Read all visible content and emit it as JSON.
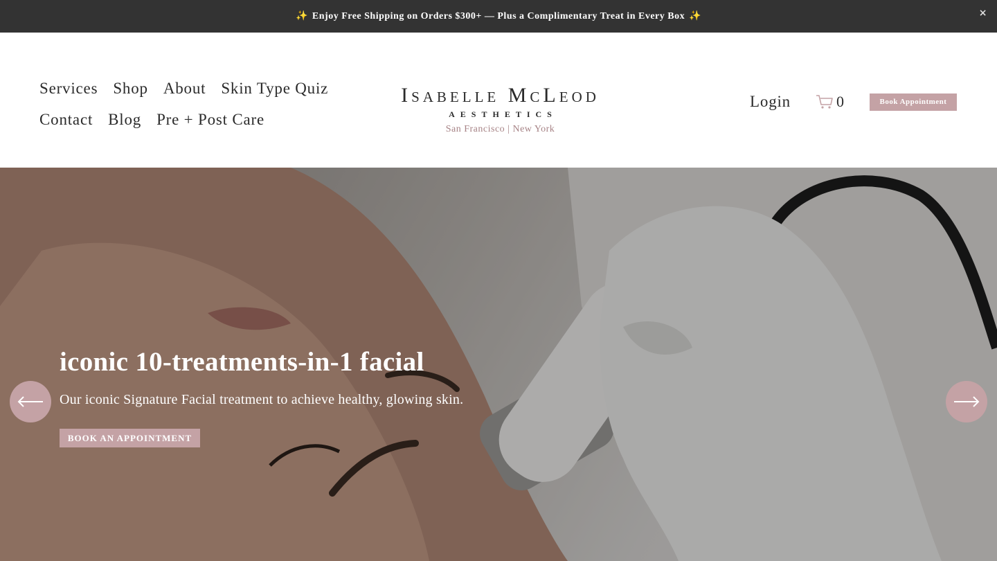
{
  "announcement": {
    "sparkle": "✨",
    "text": "Enjoy Free Shipping on Orders $300+ — Plus a Complimentary Treat in Every Box",
    "close_label": "×"
  },
  "nav": {
    "row1": [
      "Services",
      "Shop",
      "About",
      "Skin Type Quiz"
    ],
    "row2": [
      "Contact",
      "Blog",
      "Pre + Post Care"
    ]
  },
  "logo": {
    "name": "Isabelle McLeod",
    "subtitle": "AESTHETICS",
    "locations": "San Francisco | New York"
  },
  "header_tools": {
    "login_label": "Login",
    "cart_icon": "cart-icon",
    "cart_count": "0",
    "book_label": "Book Appointment"
  },
  "hero": {
    "title": "iconic 10-treatments-in-1 facial",
    "subtitle": "Our iconic Signature Facial treatment to achieve healthy, glowing skin.",
    "cta_label": "BOOK AN APPOINTMENT",
    "prev_icon": "arrow-left-icon",
    "next_icon": "arrow-right-icon"
  },
  "colors": {
    "accent": "#c4a2a5",
    "announcement_bg": "#333333",
    "location_text": "#a68285"
  }
}
